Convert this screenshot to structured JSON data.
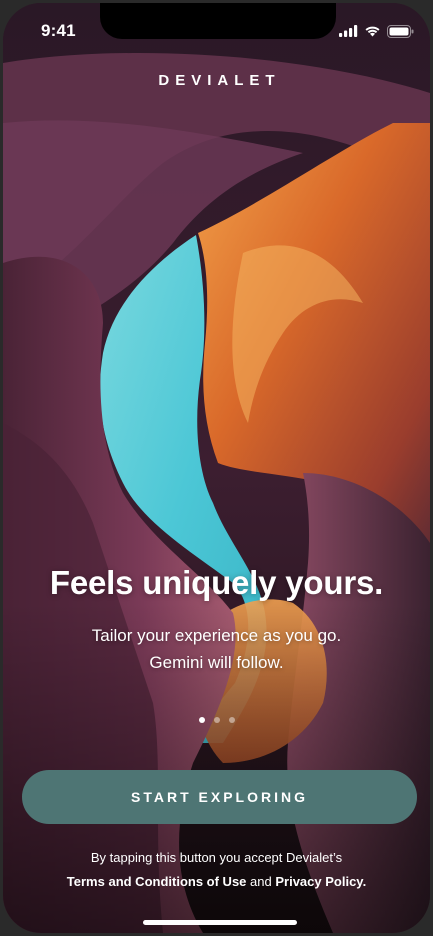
{
  "status_bar": {
    "time": "9:41",
    "icons": [
      "signal-icon",
      "wifi-icon",
      "battery-icon"
    ]
  },
  "brand": {
    "logo_text": "DEVIALET"
  },
  "onboarding": {
    "headline": "Feels uniquely yours.",
    "subtext_line1": "Tailor your experience as you go.",
    "subtext_line2": "Gemini will follow.",
    "page_count": 3,
    "active_page": 1
  },
  "cta": {
    "label": "START EXPLORING",
    "color": "#4e7574"
  },
  "legal": {
    "prefix": "By tapping this button you accept Devialet’s",
    "terms_link": "Terms and Conditions of Use",
    "conjunction": "and",
    "privacy_link": "Privacy Policy."
  },
  "colors": {
    "sky": "#52c9d6",
    "rock_orange": "#e07a2c",
    "rock_purple": "#5a2a45"
  }
}
